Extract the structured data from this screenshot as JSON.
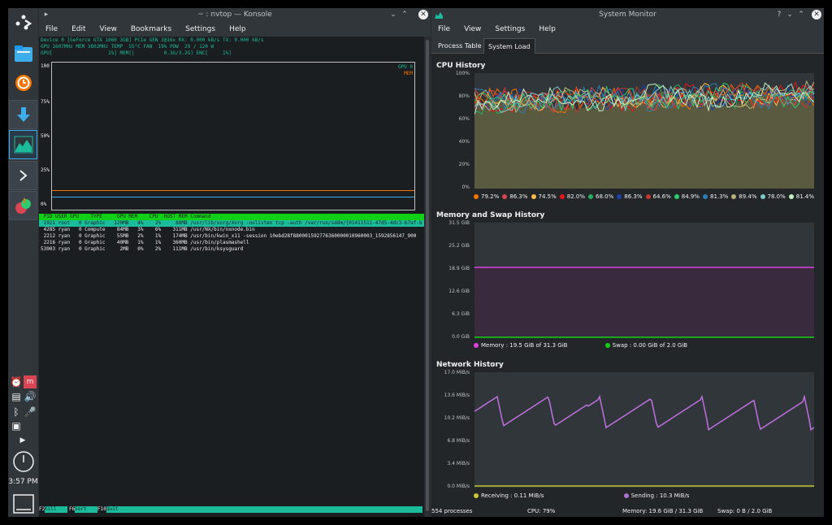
{
  "panel": {
    "launchers": [
      "kde-launcher-icon",
      "dolphin-icon",
      "ktimer-icon"
    ],
    "tasks": [
      "download-icon",
      "system-monitor-icon",
      "konsole-icon",
      "game-icon"
    ],
    "clock": "3:57 PM"
  },
  "konsole": {
    "title": "~ : nvtop — Konsole",
    "menu": [
      "File",
      "Edit",
      "View",
      "Bookmarks",
      "Settings",
      "Help"
    ],
    "nvtop": {
      "device_line": "Device 0 [GeForce GTX 1060 3GB] PCIe GEN 3@16x RX: 0.000 kB/s TX: 0.000 kB/s",
      "clock_line": "GPU 1607MHz MEM 3802MHz TEMP  55°C FAN  19% POW  29 / 120 W",
      "util_line": "GPU[                   1%] MEM[|          0.3G/3.2G] ENC[     1%]",
      "graph_y": [
        "100",
        "75%",
        "50%",
        "25%",
        "0%"
      ],
      "graph_legend": [
        "GPU 0",
        "MEM"
      ],
      "proc_header": " PID USER GPU    TYPE     GPU MEM    CPU  HOST MEM Command",
      "processes": [
        " 1921 root   0 Graphic   120MB   4%    2%     88MB /usr/lib/xorg/Xorg -nolisten tcp -auth /var/run/sddm/{01411511-47d5-4dc3-b7af-b",
        " 4285 ryan   0 Compute    84MB   3%    6%    311MB /usr/NX/bin/nxnode.bin",
        " 2212 ryan   0 Graphic    55MB   2%    1%    174MB /usr/bin/kwin_x11 -session 10ebd28f880001592776360000010960003_1592856147_900",
        " 2216 ryan   0 Graphic    40MB   1%    1%    360MB /usr/bin/plasmashell",
        "53903 ryan   0 Graphic     2MB   0%    2%    111MB /usr/bin/ksysguard"
      ],
      "fkeys": [
        {
          "key": "F2",
          "label": "Kill"
        },
        {
          "key": "F6",
          "label": "Sort"
        },
        {
          "key": "F10",
          "label": "Quit"
        }
      ]
    }
  },
  "sysmon": {
    "title": "System Monitor",
    "menu": [
      "File",
      "View",
      "Settings",
      "Help"
    ],
    "tabs": [
      "Process Table",
      "System Load"
    ],
    "cpu": {
      "title": "CPU History",
      "y_ticks": [
        "100%",
        "80%",
        "60%",
        "40%",
        "20%",
        "0%"
      ],
      "legend": [
        {
          "label": "79.2%",
          "color": "#f67400"
        },
        {
          "label": "86.3%",
          "color": "#da4453"
        },
        {
          "label": "74.5%",
          "color": "#fdbc4b"
        },
        {
          "label": "82.0%",
          "color": "#ed1515"
        },
        {
          "label": "68.0%",
          "color": "#27ae60"
        },
        {
          "label": "86.3%",
          "color": "#1d3fb0"
        },
        {
          "label": "64.6%",
          "color": "#c0392b"
        },
        {
          "label": "84.9%",
          "color": "#2ecc71"
        },
        {
          "label": "81.3%",
          "color": "#2980b9"
        },
        {
          "label": "89.4%",
          "color": "#b9b07a"
        },
        {
          "label": "78.0%",
          "color": "#7ec8c8"
        },
        {
          "label": "81.4%",
          "color": "#c8f0c0"
        }
      ]
    },
    "memory": {
      "title": "Memory and Swap History",
      "y_ticks": [
        "31.5 GiB",
        "25.2 GiB",
        "18.9 GiB",
        "12.6 GiB",
        "6.3 GiB",
        "0.0 GiB"
      ],
      "legend": [
        {
          "label": "Memory : 19.5 GiB of 31.3 GiB",
          "color": "#e040e0"
        },
        {
          "label": "Swap : 0.00 GiB of 2.0 GiB",
          "color": "#11d116"
        }
      ]
    },
    "network": {
      "title": "Network History",
      "y_ticks": [
        "17.0 MiB/s",
        "13.6 MiB/s",
        "10.2 MiB/s",
        "6.8 MiB/s",
        "3.4 MiB/s",
        "0.0 MiB/s"
      ],
      "legend": [
        {
          "label": "Receiving : 0.11 MiB/s",
          "color": "#c8c830"
        },
        {
          "label": "Sending : 10.3 MiB/s",
          "color": "#b070d0"
        }
      ]
    },
    "status": {
      "processes": "554 processes",
      "cpu": "CPU: 79%",
      "memory": "Memory: 19.6 GiB / 31.3 GiB",
      "swap": "Swap: 0 B / 2.0 GiB"
    }
  },
  "colors": {
    "accent": "#1abc9c",
    "memory_line": "#e040e0",
    "swap_line": "#11d116",
    "sending_line": "#c070e0",
    "receiving_line": "#c8c830"
  }
}
